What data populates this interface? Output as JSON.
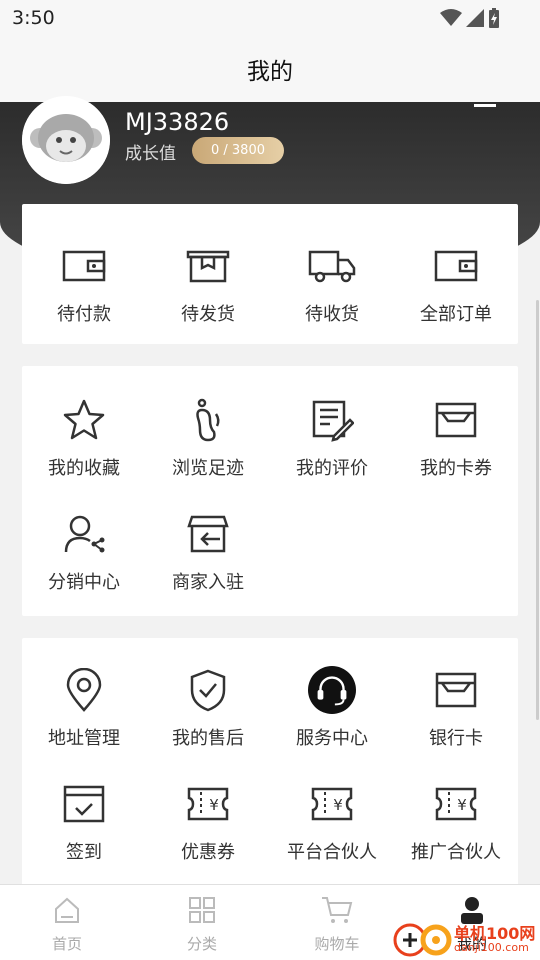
{
  "status_bar": {
    "time": "3:50"
  },
  "nav": {
    "title": "我的"
  },
  "profile": {
    "username": "MJ33826",
    "growth_label": "成长值",
    "growth_value": "0 / 3800",
    "avatar_icon": "monkey-avatar-icon"
  },
  "orders": [
    {
      "label": "待付款",
      "icon": "wallet-icon"
    },
    {
      "label": "待发货",
      "icon": "package-box-icon"
    },
    {
      "label": "待收货",
      "icon": "truck-icon"
    },
    {
      "label": "全部订单",
      "icon": "wallet-icon"
    }
  ],
  "tools": [
    {
      "label": "我的收藏",
      "icon": "star-icon"
    },
    {
      "label": "浏览足迹",
      "icon": "footprint-icon"
    },
    {
      "label": "我的评价",
      "icon": "review-edit-icon"
    },
    {
      "label": "我的卡券",
      "icon": "card-box-icon"
    },
    {
      "label": "分销中心",
      "icon": "user-share-icon"
    },
    {
      "label": "商家入驻",
      "icon": "store-enter-icon"
    }
  ],
  "services": [
    {
      "label": "地址管理",
      "icon": "location-pin-icon"
    },
    {
      "label": "我的售后",
      "icon": "shield-check-icon"
    },
    {
      "label": "服务中心",
      "icon": "headset-icon"
    },
    {
      "label": "银行卡",
      "icon": "card-box-icon"
    },
    {
      "label": "签到",
      "icon": "checkin-icon"
    },
    {
      "label": "优惠券",
      "icon": "coupon-icon"
    },
    {
      "label": "平台合伙人",
      "icon": "coupon-icon"
    },
    {
      "label": "推广合伙人",
      "icon": "coupon-icon"
    }
  ],
  "tab_bar": {
    "tabs": [
      {
        "label": "首页",
        "icon": "home-icon",
        "active": false
      },
      {
        "label": "分类",
        "icon": "grid-icon",
        "active": false
      },
      {
        "label": "购物车",
        "icon": "cart-icon",
        "active": false
      },
      {
        "label": "我的",
        "icon": "profile-icon",
        "active": true
      }
    ]
  },
  "watermark": {
    "text": "单机100网",
    "sub": "danji100.com"
  },
  "colors": {
    "header_dark": "#2c2c2c",
    "pill_gold": "#c9a877",
    "text": "#333333",
    "tab_inactive": "#aaaaaa"
  }
}
